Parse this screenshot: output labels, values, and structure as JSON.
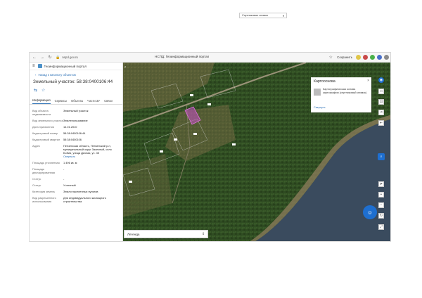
{
  "browser": {
    "address": "nspd.gov.ru",
    "title": "НСПД: Геоинформационный портал",
    "right_label": "Сохранить",
    "colors": {
      "ext1": "#e0c64a",
      "ext2": "#c94a4a",
      "ext3": "#4ab04a",
      "ext4": "#4a70c9",
      "ext5": "#8a8a8a"
    }
  },
  "sidebar": {
    "portal": "Геоинформационный портал",
    "back": "Назад к каталогу объектов",
    "title": "Земельный участок: 58:38:0400106:44",
    "tabs": [
      "Информация",
      "Сервисы",
      "Объекты",
      "Части ЗУ",
      "Связи"
    ],
    "attrs": [
      {
        "k": "Вид объекта недвижимости",
        "v": "Земельный участок"
      },
      {
        "k": "Вид земельного участка",
        "v": "Землепользование"
      },
      {
        "k": "Дата присвоения",
        "v": "14.01.2010"
      },
      {
        "k": "Кадастровый номер",
        "v": "58:38:0400106:44"
      },
      {
        "k": "Кадастровый квартал",
        "v": "58:38:0400106"
      },
      {
        "k": "Адрес",
        "v": "Пензенская область, Пензенский р-н, муниципальный округ Засечный, село Бобия, улица Дачная, уч. 35",
        "more": "Свернуть"
      },
      {
        "k": "Площадь уточненная",
        "v": "1 496 кв. м"
      },
      {
        "k": "Площадь декларированная",
        "v": "-"
      },
      {
        "k": "Статус",
        "v": "-"
      },
      {
        "k": "Статус",
        "v": "Учтенный"
      },
      {
        "k": "Категория земель",
        "v": "Земли населенных пунктов"
      },
      {
        "k": "Вид разрешенного использования",
        "v": "Для индивидуального жилищного строительства"
      }
    ]
  },
  "map": {
    "collapse": "‹",
    "layer_select": "Спутниковые снимки",
    "cartography": {
      "title": "Картоосновa",
      "desc": "Картографическая основа картографии (спутниковый снимок)",
      "link": "Свернуть"
    },
    "legend": "Легенда",
    "chat": "☺",
    "colors": {
      "forest": "#2e4a1f",
      "field": "#6a6a3c",
      "water": "#3a4b5e",
      "sand": "#8a7a5a",
      "parcel": "#c850c8"
    }
  }
}
